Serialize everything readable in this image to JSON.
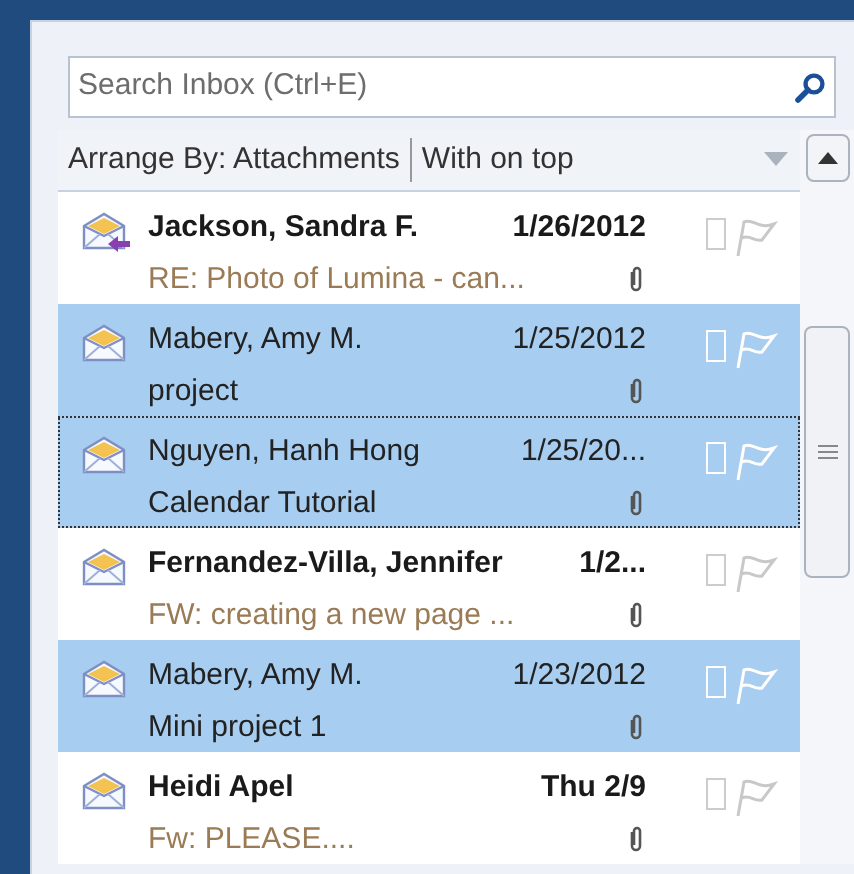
{
  "search": {
    "placeholder": "Search Inbox (Ctrl+E)"
  },
  "arrange": {
    "label": "Arrange By: Attachments",
    "order": "With on top"
  },
  "messages": [
    {
      "kind": "replied",
      "sender": "Jackson, Sandra F.",
      "date": "1/26/2012",
      "subject": "RE: Photo of Lumina - can...",
      "unread": true,
      "selected": false,
      "focused": false
    },
    {
      "kind": "read",
      "sender": "Mabery, Amy M.",
      "date": "1/25/2012",
      "subject": "project",
      "unread": false,
      "selected": true,
      "focused": false
    },
    {
      "kind": "read",
      "sender": "Nguyen, Hanh Hong",
      "date": "1/25/20...",
      "subject": "Calendar Tutorial",
      "unread": false,
      "selected": true,
      "focused": true
    },
    {
      "kind": "read",
      "sender": "Fernandez-Villa, Jennifer",
      "date": "1/2...",
      "subject": "FW: creating a new page ...",
      "unread": true,
      "selected": false,
      "focused": false
    },
    {
      "kind": "read",
      "sender": "Mabery, Amy M.",
      "date": "1/23/2012",
      "subject": "Mini project 1",
      "unread": false,
      "selected": true,
      "focused": false
    },
    {
      "kind": "read",
      "sender": "Heidi Apel",
      "date": "Thu 2/9",
      "subject": "Fw: PLEASE....",
      "unread": true,
      "selected": false,
      "focused": false
    }
  ]
}
